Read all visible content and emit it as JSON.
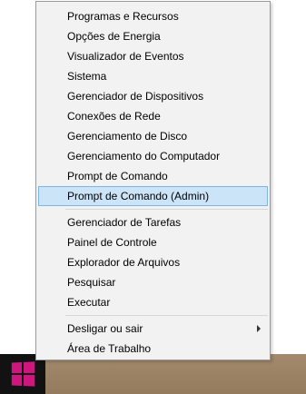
{
  "menu": {
    "group1": [
      {
        "label": "Programas e Recursos"
      },
      {
        "label": "Opções de Energia"
      },
      {
        "label": "Visualizador de Eventos"
      },
      {
        "label": "Sistema"
      },
      {
        "label": "Gerenciador de Dispositivos"
      },
      {
        "label": "Conexões de Rede"
      },
      {
        "label": "Gerenciamento de Disco"
      },
      {
        "label": "Gerenciamento do Computador"
      },
      {
        "label": "Prompt de Comando"
      },
      {
        "label": "Prompt de Comando (Admin)",
        "selected": true
      }
    ],
    "group2": [
      {
        "label": "Gerenciador de Tarefas"
      },
      {
        "label": "Painel de Controle"
      },
      {
        "label": "Explorador de Arquivos"
      },
      {
        "label": "Pesquisar"
      },
      {
        "label": "Executar"
      }
    ],
    "group3": [
      {
        "label": "Desligar ou sair",
        "has_submenu": true
      },
      {
        "label": "Área de Trabalho"
      }
    ]
  },
  "colors": {
    "selected_bg": "#cce4f7",
    "selected_border": "#7eb4ea",
    "start_logo": "#d0157f",
    "taskbar": "#121212"
  },
  "icons": {
    "start": "windows-logo-icon",
    "submenu": "chevron-right-icon"
  }
}
